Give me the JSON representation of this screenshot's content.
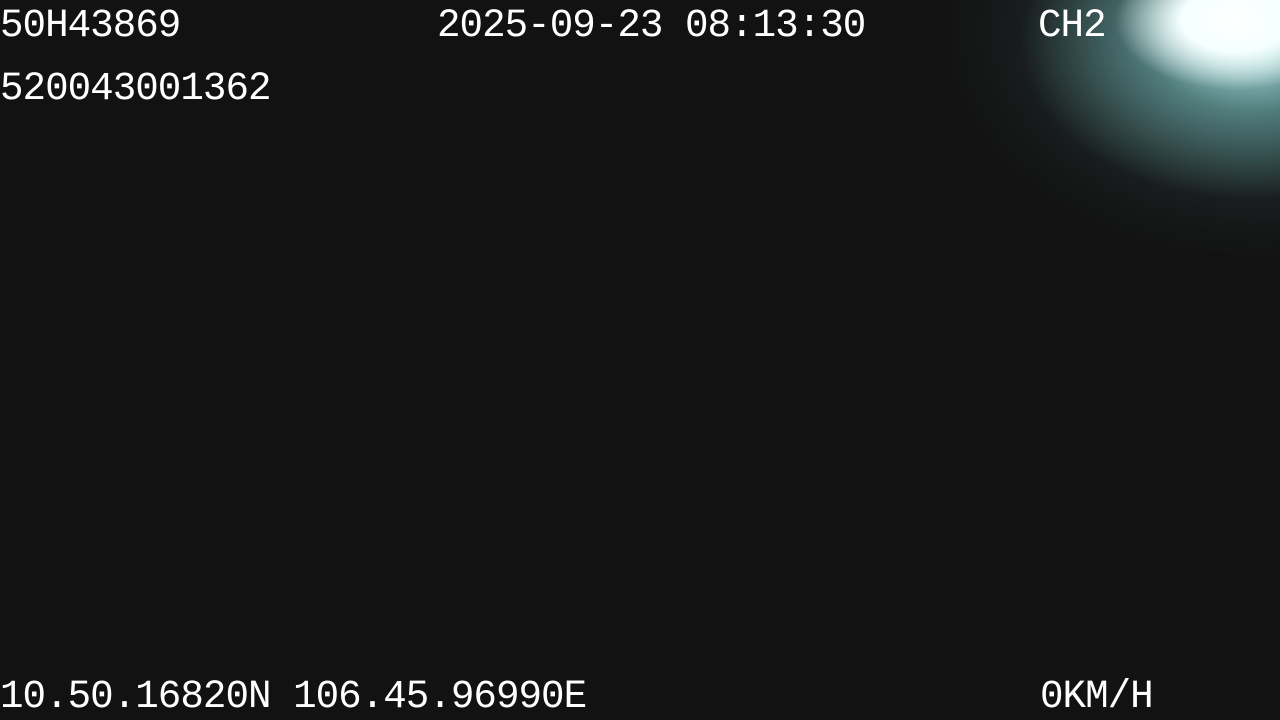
{
  "overlay": {
    "plate": "50H43869",
    "datetime": "2025-09-23 08:13:30",
    "channel": "CH2",
    "device_id": "520043001362",
    "coordinates": "10.50.16820N 106.45.96990E",
    "speed": "0KM/H"
  },
  "colors": {
    "background": "#121212",
    "text": "#ffffff",
    "glare": "#d8f4f4"
  }
}
